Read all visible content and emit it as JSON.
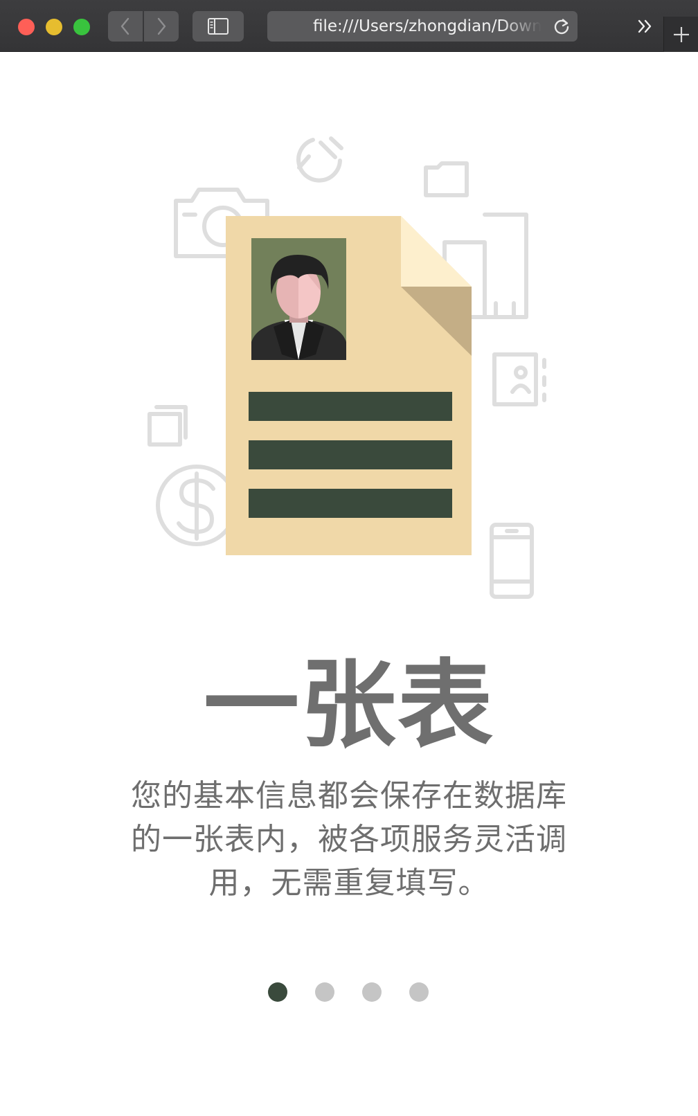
{
  "browser": {
    "url": "file:///Users/zhongdian/Downloads",
    "icons": {
      "back": "chevron-left-icon",
      "forward": "chevron-right-icon",
      "sidebar": "sidebar-icon",
      "reload": "reload-icon",
      "overflow": "double-chevron-right-icon",
      "new_tab": "plus-icon"
    }
  },
  "slide": {
    "title": "一张表",
    "description": "您的基本信息都会保存在数据库的一张表内，被各项服务灵活调用，无需重复填写。",
    "total_slides": 4,
    "current_slide": 1
  },
  "colors": {
    "document": "#f0d8a8",
    "document_fold": "#c4ae86",
    "document_lines": "#3a4a3c",
    "photo_background": "#72805a",
    "title_text": "#6f6f6f",
    "body_text": "#6e6e6e",
    "dot_active": "#3a4a3c",
    "dot_inactive": "#c5c5c5",
    "background_icons": "#dedede"
  },
  "background_icons": [
    "hammer-sickle-icon",
    "folder-icon",
    "camera-icon",
    "building-icon",
    "contact-book-icon",
    "books-icon",
    "dollar-coin-icon",
    "smartphone-icon"
  ]
}
